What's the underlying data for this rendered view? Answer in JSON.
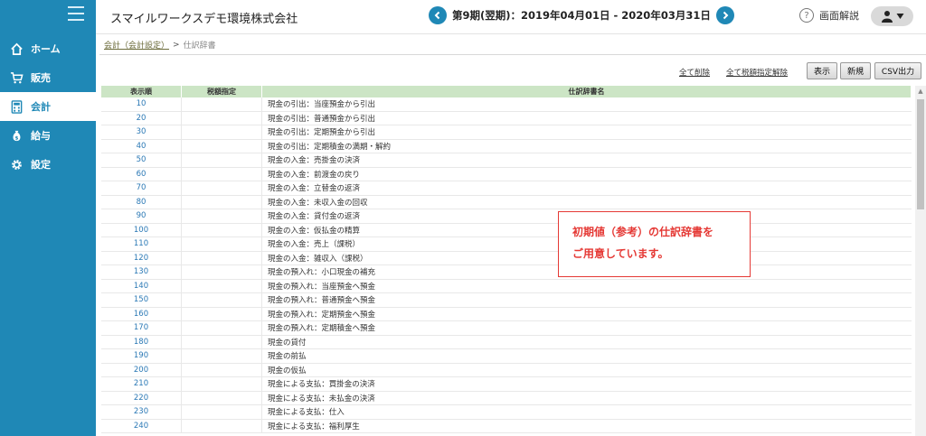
{
  "sidebar": {
    "items": [
      {
        "label": "ホーム",
        "icon": "home-icon"
      },
      {
        "label": "販売",
        "icon": "cart-icon"
      },
      {
        "label": "会計",
        "icon": "calculator-icon"
      },
      {
        "label": "給与",
        "icon": "money-bag-icon"
      },
      {
        "label": "設定",
        "icon": "gear-icon"
      }
    ],
    "active": "会計"
  },
  "header": {
    "company": "スマイルワークスデモ環境株式会社",
    "period": "第9期(翌期)：2019年04月01日 - 2020年03月31日",
    "help_label": "画面解説"
  },
  "breadcrumb": {
    "parent": "会計（会計設定）",
    "separator": ">",
    "current": "仕訳辞書"
  },
  "toolbar": {
    "delete_all": "全て削除",
    "release_tax_all": "全て税額指定解除",
    "display": "表示",
    "new": "新規",
    "csv": "CSV出力"
  },
  "table": {
    "headers": [
      "表示順",
      "税額指定",
      "仕訳辞書名"
    ],
    "rows": [
      {
        "order": "10",
        "tax": "",
        "name": "現金の引出：当座預金から引出"
      },
      {
        "order": "20",
        "tax": "",
        "name": "現金の引出：普通預金から引出"
      },
      {
        "order": "30",
        "tax": "",
        "name": "現金の引出：定期預金から引出"
      },
      {
        "order": "40",
        "tax": "",
        "name": "現金の引出：定期積金の満期・解約"
      },
      {
        "order": "50",
        "tax": "",
        "name": "現金の入金：売掛金の決済"
      },
      {
        "order": "60",
        "tax": "",
        "name": "現金の入金：前渡金の戻り"
      },
      {
        "order": "70",
        "tax": "",
        "name": "現金の入金：立替金の返済"
      },
      {
        "order": "80",
        "tax": "",
        "name": "現金の入金：未収入金の回収"
      },
      {
        "order": "90",
        "tax": "",
        "name": "現金の入金：貸付金の返済"
      },
      {
        "order": "100",
        "tax": "",
        "name": "現金の入金：仮払金の精算"
      },
      {
        "order": "110",
        "tax": "",
        "name": "現金の入金：売上（課税）"
      },
      {
        "order": "120",
        "tax": "",
        "name": "現金の入金：雑収入（課税）"
      },
      {
        "order": "130",
        "tax": "",
        "name": "現金の預入れ：小口現金の補充"
      },
      {
        "order": "140",
        "tax": "",
        "name": "現金の預入れ：当座預金へ預金"
      },
      {
        "order": "150",
        "tax": "",
        "name": "現金の預入れ：普通預金へ預金"
      },
      {
        "order": "160",
        "tax": "",
        "name": "現金の預入れ：定期預金へ預金"
      },
      {
        "order": "170",
        "tax": "",
        "name": "現金の預入れ：定期積金へ預金"
      },
      {
        "order": "180",
        "tax": "",
        "name": "現金の貸付"
      },
      {
        "order": "190",
        "tax": "",
        "name": "現金の前払"
      },
      {
        "order": "200",
        "tax": "",
        "name": "現金の仮払"
      },
      {
        "order": "210",
        "tax": "",
        "name": "現金による支払：買掛金の決済"
      },
      {
        "order": "220",
        "tax": "",
        "name": "現金による支払：未払金の決済"
      },
      {
        "order": "230",
        "tax": "",
        "name": "現金による支払：仕入"
      },
      {
        "order": "240",
        "tax": "",
        "name": "現金による支払：福利厚生"
      }
    ]
  },
  "callout": {
    "line1": "初期値（参考）の仕訳辞書を",
    "line2": "ご用意しています。"
  },
  "colors": {
    "sidebar": "#1f88b6",
    "header_row": "#cce5c5",
    "link": "#2a78b5",
    "callout": "#e53935"
  }
}
